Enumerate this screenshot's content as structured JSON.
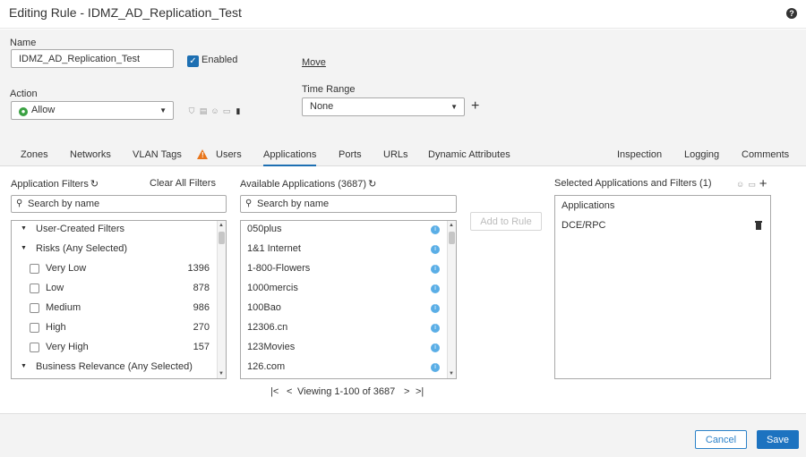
{
  "window": {
    "title": "Editing Rule - IDMZ_AD_Replication_Test",
    "help_glyph": "?"
  },
  "form": {
    "name_label": "Name",
    "name_value": "IDMZ_AD_Replication_Test",
    "enabled_label": "Enabled",
    "move_label": "Move",
    "action_label": "Action",
    "action_value": "Allow",
    "time_range_label": "Time Range",
    "time_range_value": "None"
  },
  "tabs": [
    {
      "label": "Zones"
    },
    {
      "label": "Networks"
    },
    {
      "label": "VLAN Tags"
    },
    {
      "label": "Users"
    },
    {
      "label": "Applications",
      "active": true
    },
    {
      "label": "Ports"
    },
    {
      "label": "URLs"
    },
    {
      "label": "Dynamic Attributes"
    },
    {
      "label": "Inspection"
    },
    {
      "label": "Logging"
    },
    {
      "label": "Comments"
    }
  ],
  "filters": {
    "header": "Application Filters",
    "clear_label": "Clear All Filters",
    "search_placeholder": "Search by name",
    "rows": [
      {
        "type": "group",
        "label": "User-Created Filters"
      },
      {
        "type": "group",
        "label": "Risks (Any Selected)"
      },
      {
        "type": "item",
        "label": "Very Low",
        "count": "1396"
      },
      {
        "type": "item",
        "label": "Low",
        "count": "878"
      },
      {
        "type": "item",
        "label": "Medium",
        "count": "986"
      },
      {
        "type": "item",
        "label": "High",
        "count": "270"
      },
      {
        "type": "item",
        "label": "Very High",
        "count": "157"
      },
      {
        "type": "group",
        "label": "Business Relevance (Any Selected)"
      }
    ]
  },
  "available": {
    "header": "Available Applications (3687)",
    "search_placeholder": "Search by name",
    "items": [
      "050plus",
      "1&1 Internet",
      "1-800-Flowers",
      "1000mercis",
      "100Bao",
      "12306.cn",
      "123Movies",
      "126.com"
    ],
    "pager": {
      "text": "Viewing 1-100 of 3687"
    }
  },
  "add_to_rule_label": "Add to Rule",
  "selected": {
    "header": "Selected Applications and Filters (1)",
    "group_label": "Applications",
    "items": [
      "DCE/RPC"
    ]
  },
  "footer": {
    "cancel_label": "Cancel",
    "save_label": "Save"
  },
  "colors": {
    "accent": "#1d73c0",
    "allow_green": "#3aa142",
    "warning": "#e8751a",
    "info": "#5aaee6"
  }
}
